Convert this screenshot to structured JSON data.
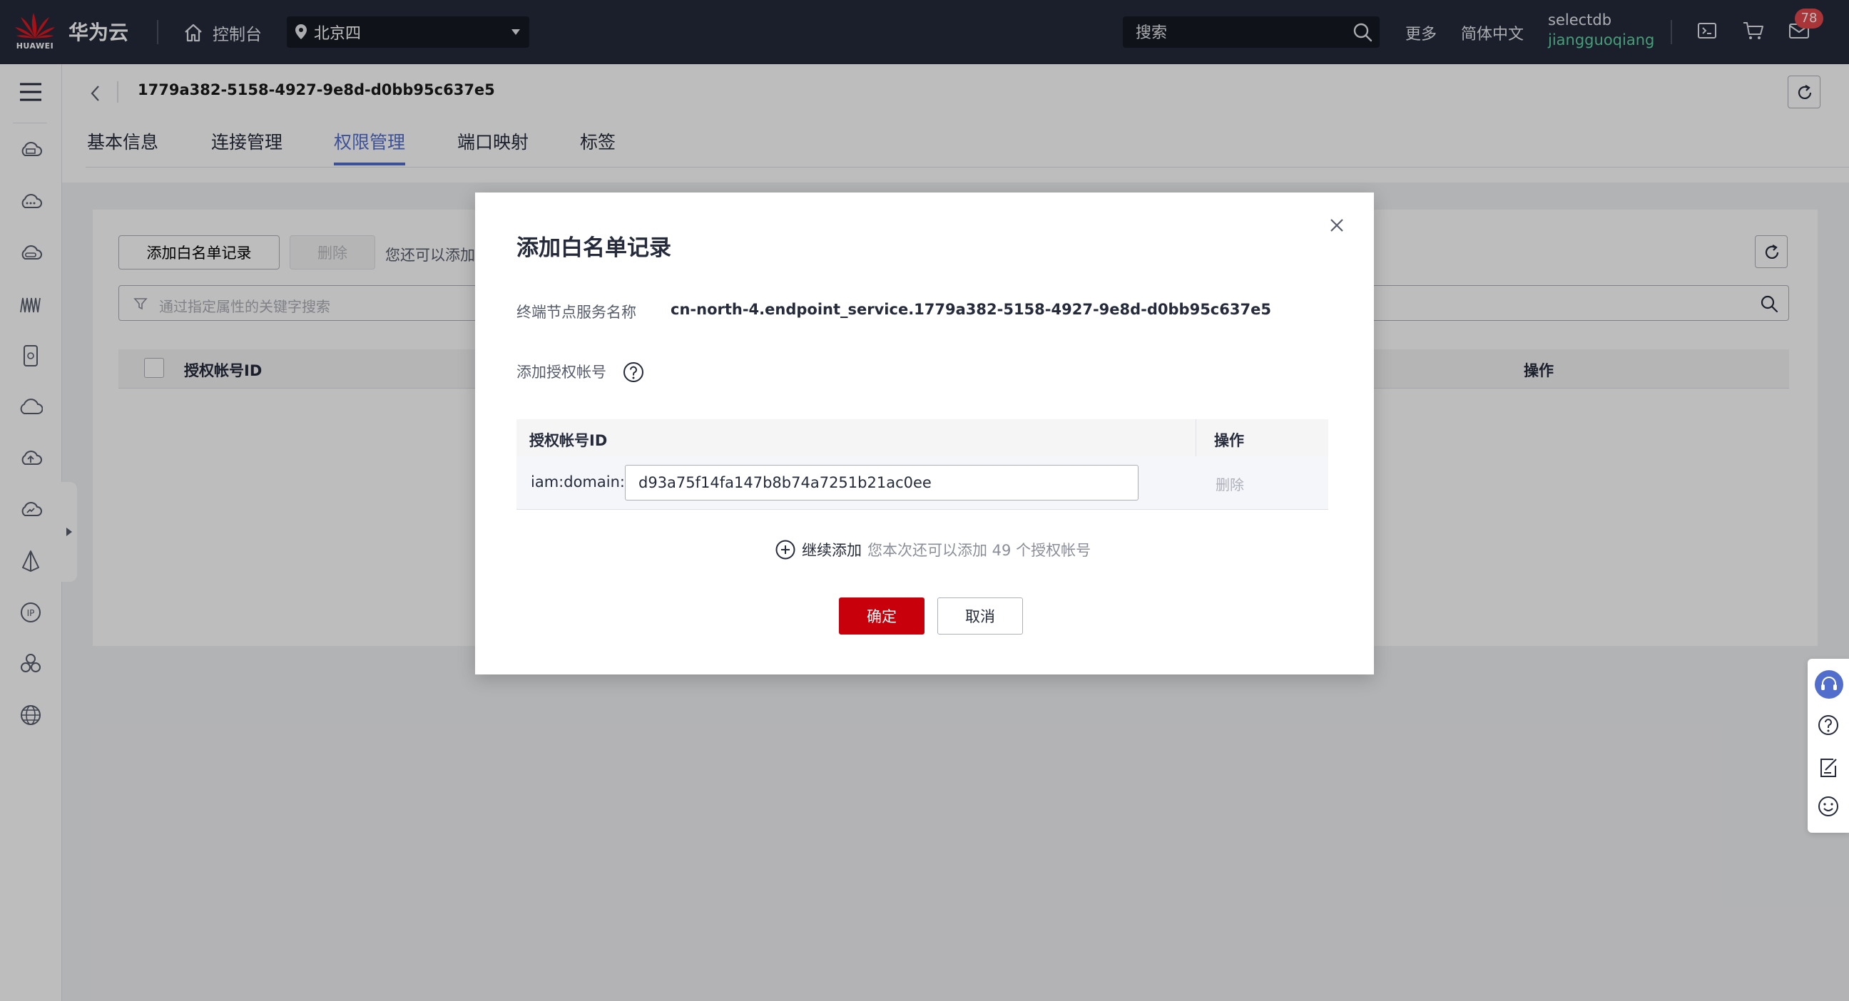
{
  "topbar": {
    "brand_word": "HUAWEI",
    "brand_name": "华为云",
    "console_label": "控制台",
    "region": "北京四",
    "search_placeholder": "搜索",
    "more_label": "更多",
    "language_label": "简体中文",
    "account_name": "selectdb",
    "user_name": "jiangguoqiang",
    "message_count": "78",
    "colors": {
      "bg": "#252b3a",
      "user_name": "#5fd6a3",
      "badge": "#e5484d"
    }
  },
  "sidebar": {
    "icons": [
      "menu-icon",
      "cloud-server-icon",
      "cloud-icon",
      "cloud-storage-icon",
      "waveform-icon",
      "phone-icon",
      "cloud-outline-icon",
      "cloud-upload-icon",
      "cloud-sync-icon",
      "network-icon",
      "ip-icon",
      "cluster-icon",
      "globe-icon"
    ]
  },
  "page": {
    "title": "1779a382-5158-4927-9e8d-d0bb95c637e5",
    "tabs": [
      {
        "label": "基本信息",
        "active": false
      },
      {
        "label": "连接管理",
        "active": false
      },
      {
        "label": "权限管理",
        "active": true
      },
      {
        "label": "端口映射",
        "active": false
      },
      {
        "label": "标签",
        "active": false
      }
    ],
    "accent_color": "#526ecc"
  },
  "whitelist": {
    "add_button": "添加白名单记录",
    "delete_button": "删除",
    "quota_text": "您还可以添加",
    "filter_placeholder": "通过指定属性的关键字搜索",
    "columns": [
      "授权帐号ID",
      "操作"
    ]
  },
  "dialog": {
    "title": "添加白名单记录",
    "service_label": "终端节点服务名称",
    "service_name": "cn-north-4.endpoint_service.1779a382-5158-4927-9e8d-d0bb95c637e5",
    "account_label": "添加授权帐号",
    "table_columns": [
      "授权帐号ID",
      "操作"
    ],
    "rows": [
      {
        "prefix": "iam:domain::",
        "value": "d93a75f14fa147b8b74a7251b21ac0ee",
        "action": "删除"
      }
    ],
    "add_more_label": "继续添加",
    "add_more_hint": "您本次还可以添加 49 个授权帐号",
    "confirm": "确定",
    "cancel": "取消",
    "confirm_color": "#c7000b"
  },
  "float_toolbar": {
    "icons": [
      "customer-service-icon",
      "help-icon",
      "feedback-icon",
      "smile-icon"
    ]
  }
}
